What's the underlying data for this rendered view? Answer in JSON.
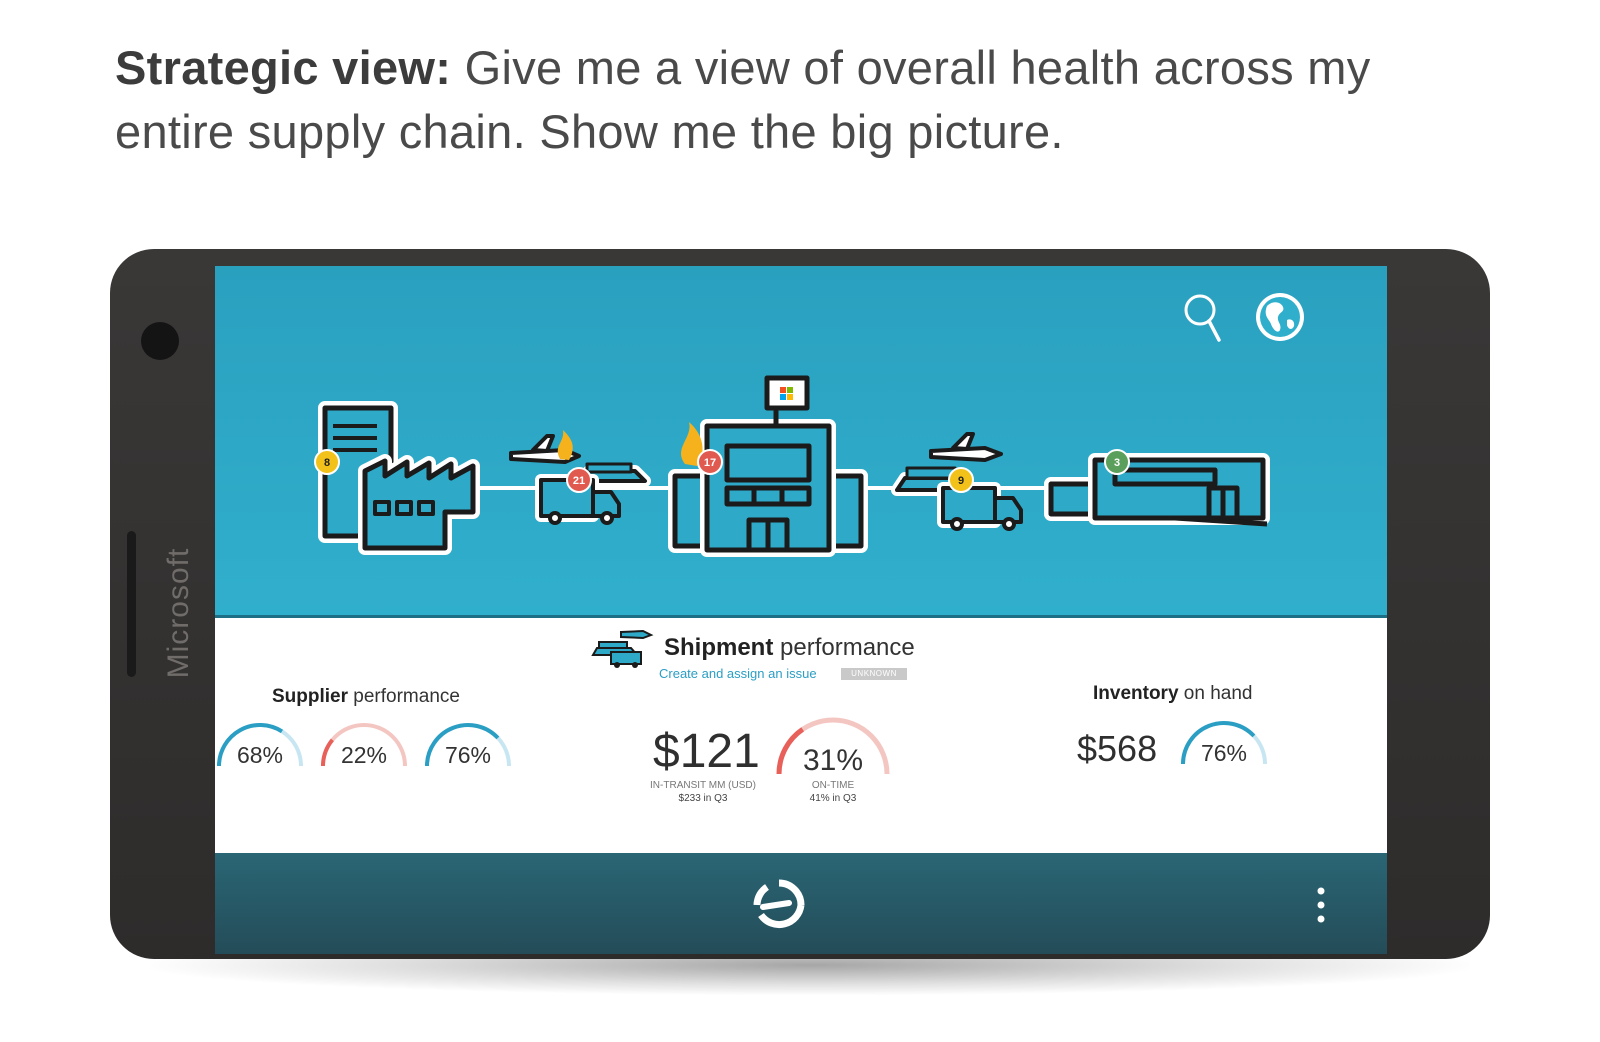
{
  "headline": {
    "bold": "Strategic view:",
    "text": " Give me a view of overall health across my entire supply chain. Show me the big picture."
  },
  "device": {
    "brand": "Microsoft"
  },
  "top_icons": {
    "search": "search-icon",
    "globe": "globe-icon"
  },
  "chain": {
    "badges": [
      {
        "value": "8",
        "color": "#f2c21b"
      },
      {
        "value": "21",
        "color": "#e15a4f"
      },
      {
        "value": "17",
        "color": "#e15a4f"
      },
      {
        "value": "9",
        "color": "#f2c21b"
      },
      {
        "value": "3",
        "color": "#5aa05c"
      }
    ]
  },
  "supplier": {
    "title_bold": "Supplier",
    "title_rest": " performance",
    "gauges": [
      {
        "label": "68%",
        "value": 0.68,
        "color": "#2b9ec4"
      },
      {
        "label": "22%",
        "value": 0.22,
        "color": "#e8605a"
      },
      {
        "label": "76%",
        "value": 0.76,
        "color": "#2b9ec4"
      }
    ]
  },
  "shipment": {
    "title_bold": "Shipment",
    "title_rest": " performance",
    "link": "Create and assign an issue",
    "tag": "UNKNOWN",
    "in_transit": {
      "value": "$121",
      "caption": "IN-TRANSIT MM (USD)",
      "sub": "$233 in Q3"
    },
    "on_time": {
      "label": "31%",
      "value": 0.31,
      "color": "#e8605a",
      "caption": "ON-TIME",
      "sub": "41% in Q3"
    }
  },
  "inventory": {
    "title_bold": "Inventory",
    "title_rest": " on hand",
    "value": "$568",
    "gauge": {
      "label": "76%",
      "value": 0.76,
      "color": "#2b9ec4"
    }
  },
  "bottom": {
    "logo": "app-logo-icon",
    "menu": "more-vert-icon"
  },
  "colors": {
    "sky": "#30afcc",
    "bar": "#244c58",
    "accent": "#2b9ec4",
    "alert": "#e8605a"
  }
}
